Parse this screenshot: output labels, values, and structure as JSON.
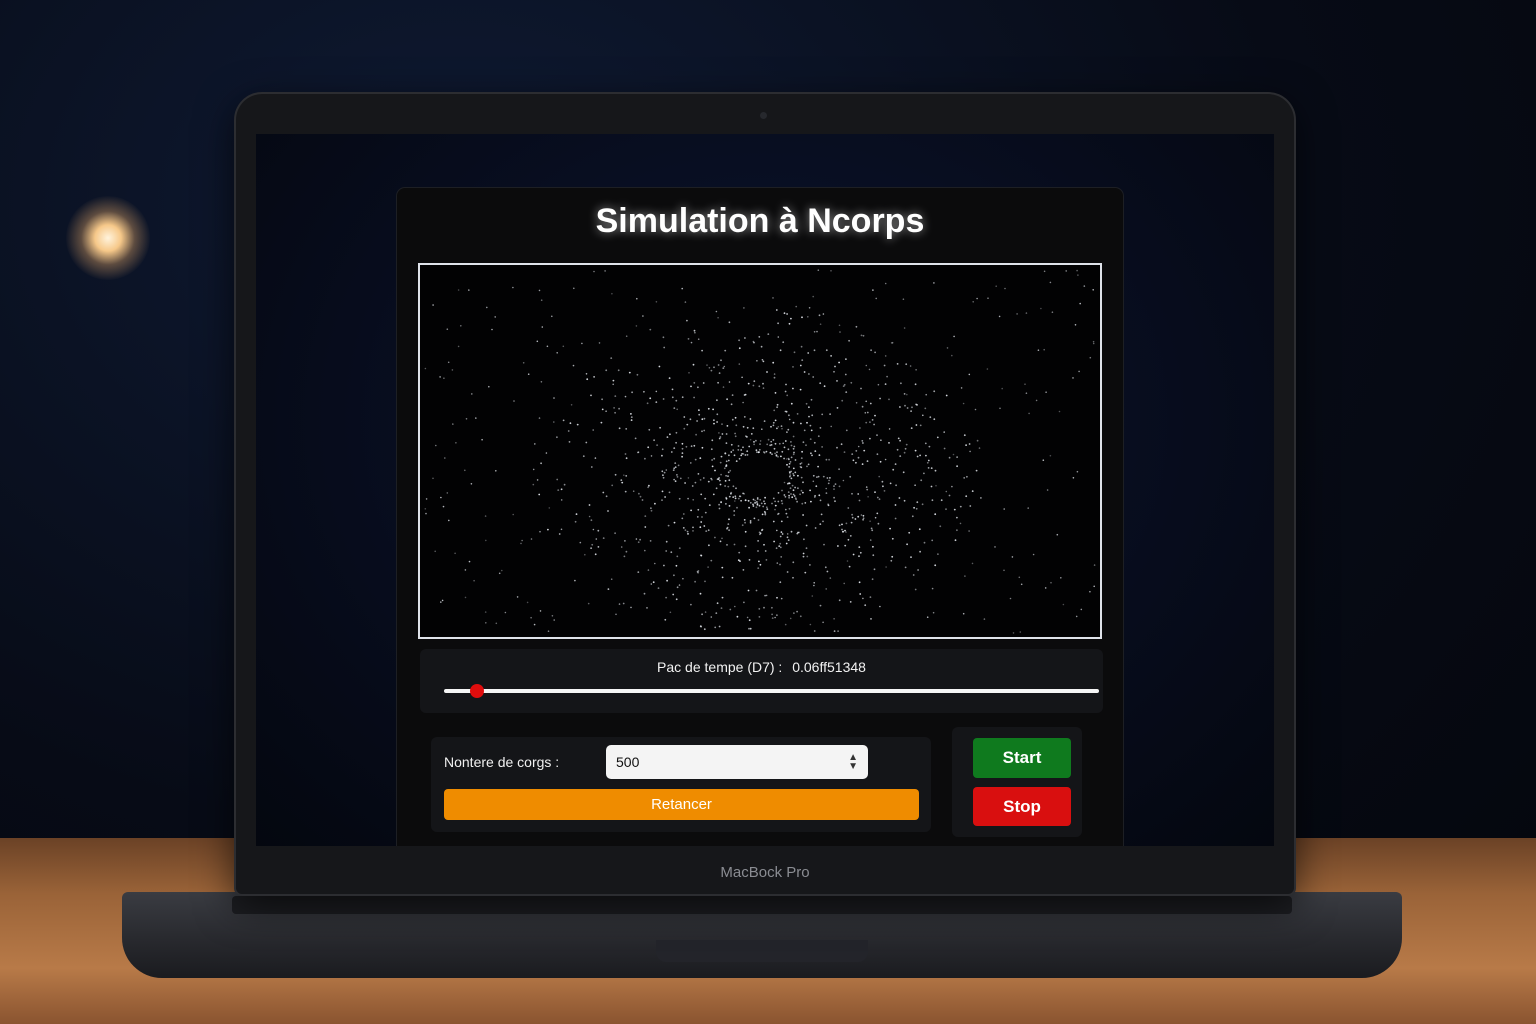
{
  "app": {
    "title": "Simulation à Ncorps"
  },
  "timestep": {
    "label": "Pac de tempe (D7) :",
    "value": "0.06ff51348",
    "slider_level_fraction": 0.05
  },
  "bodies": {
    "label": "Nontere de corgs :",
    "value": "500"
  },
  "buttons": {
    "restart": "Retancer",
    "start": "Start",
    "stop": "Stop"
  },
  "device": {
    "label": "MacBock Pro"
  },
  "colors": {
    "restart": "#ef8c00",
    "start": "#0f7a1e",
    "stop": "#d90f0f",
    "slider_thumb": "#e00d0d"
  },
  "icons": {
    "stepper": "stepper-arrows-icon",
    "camera": "webcam-icon"
  }
}
